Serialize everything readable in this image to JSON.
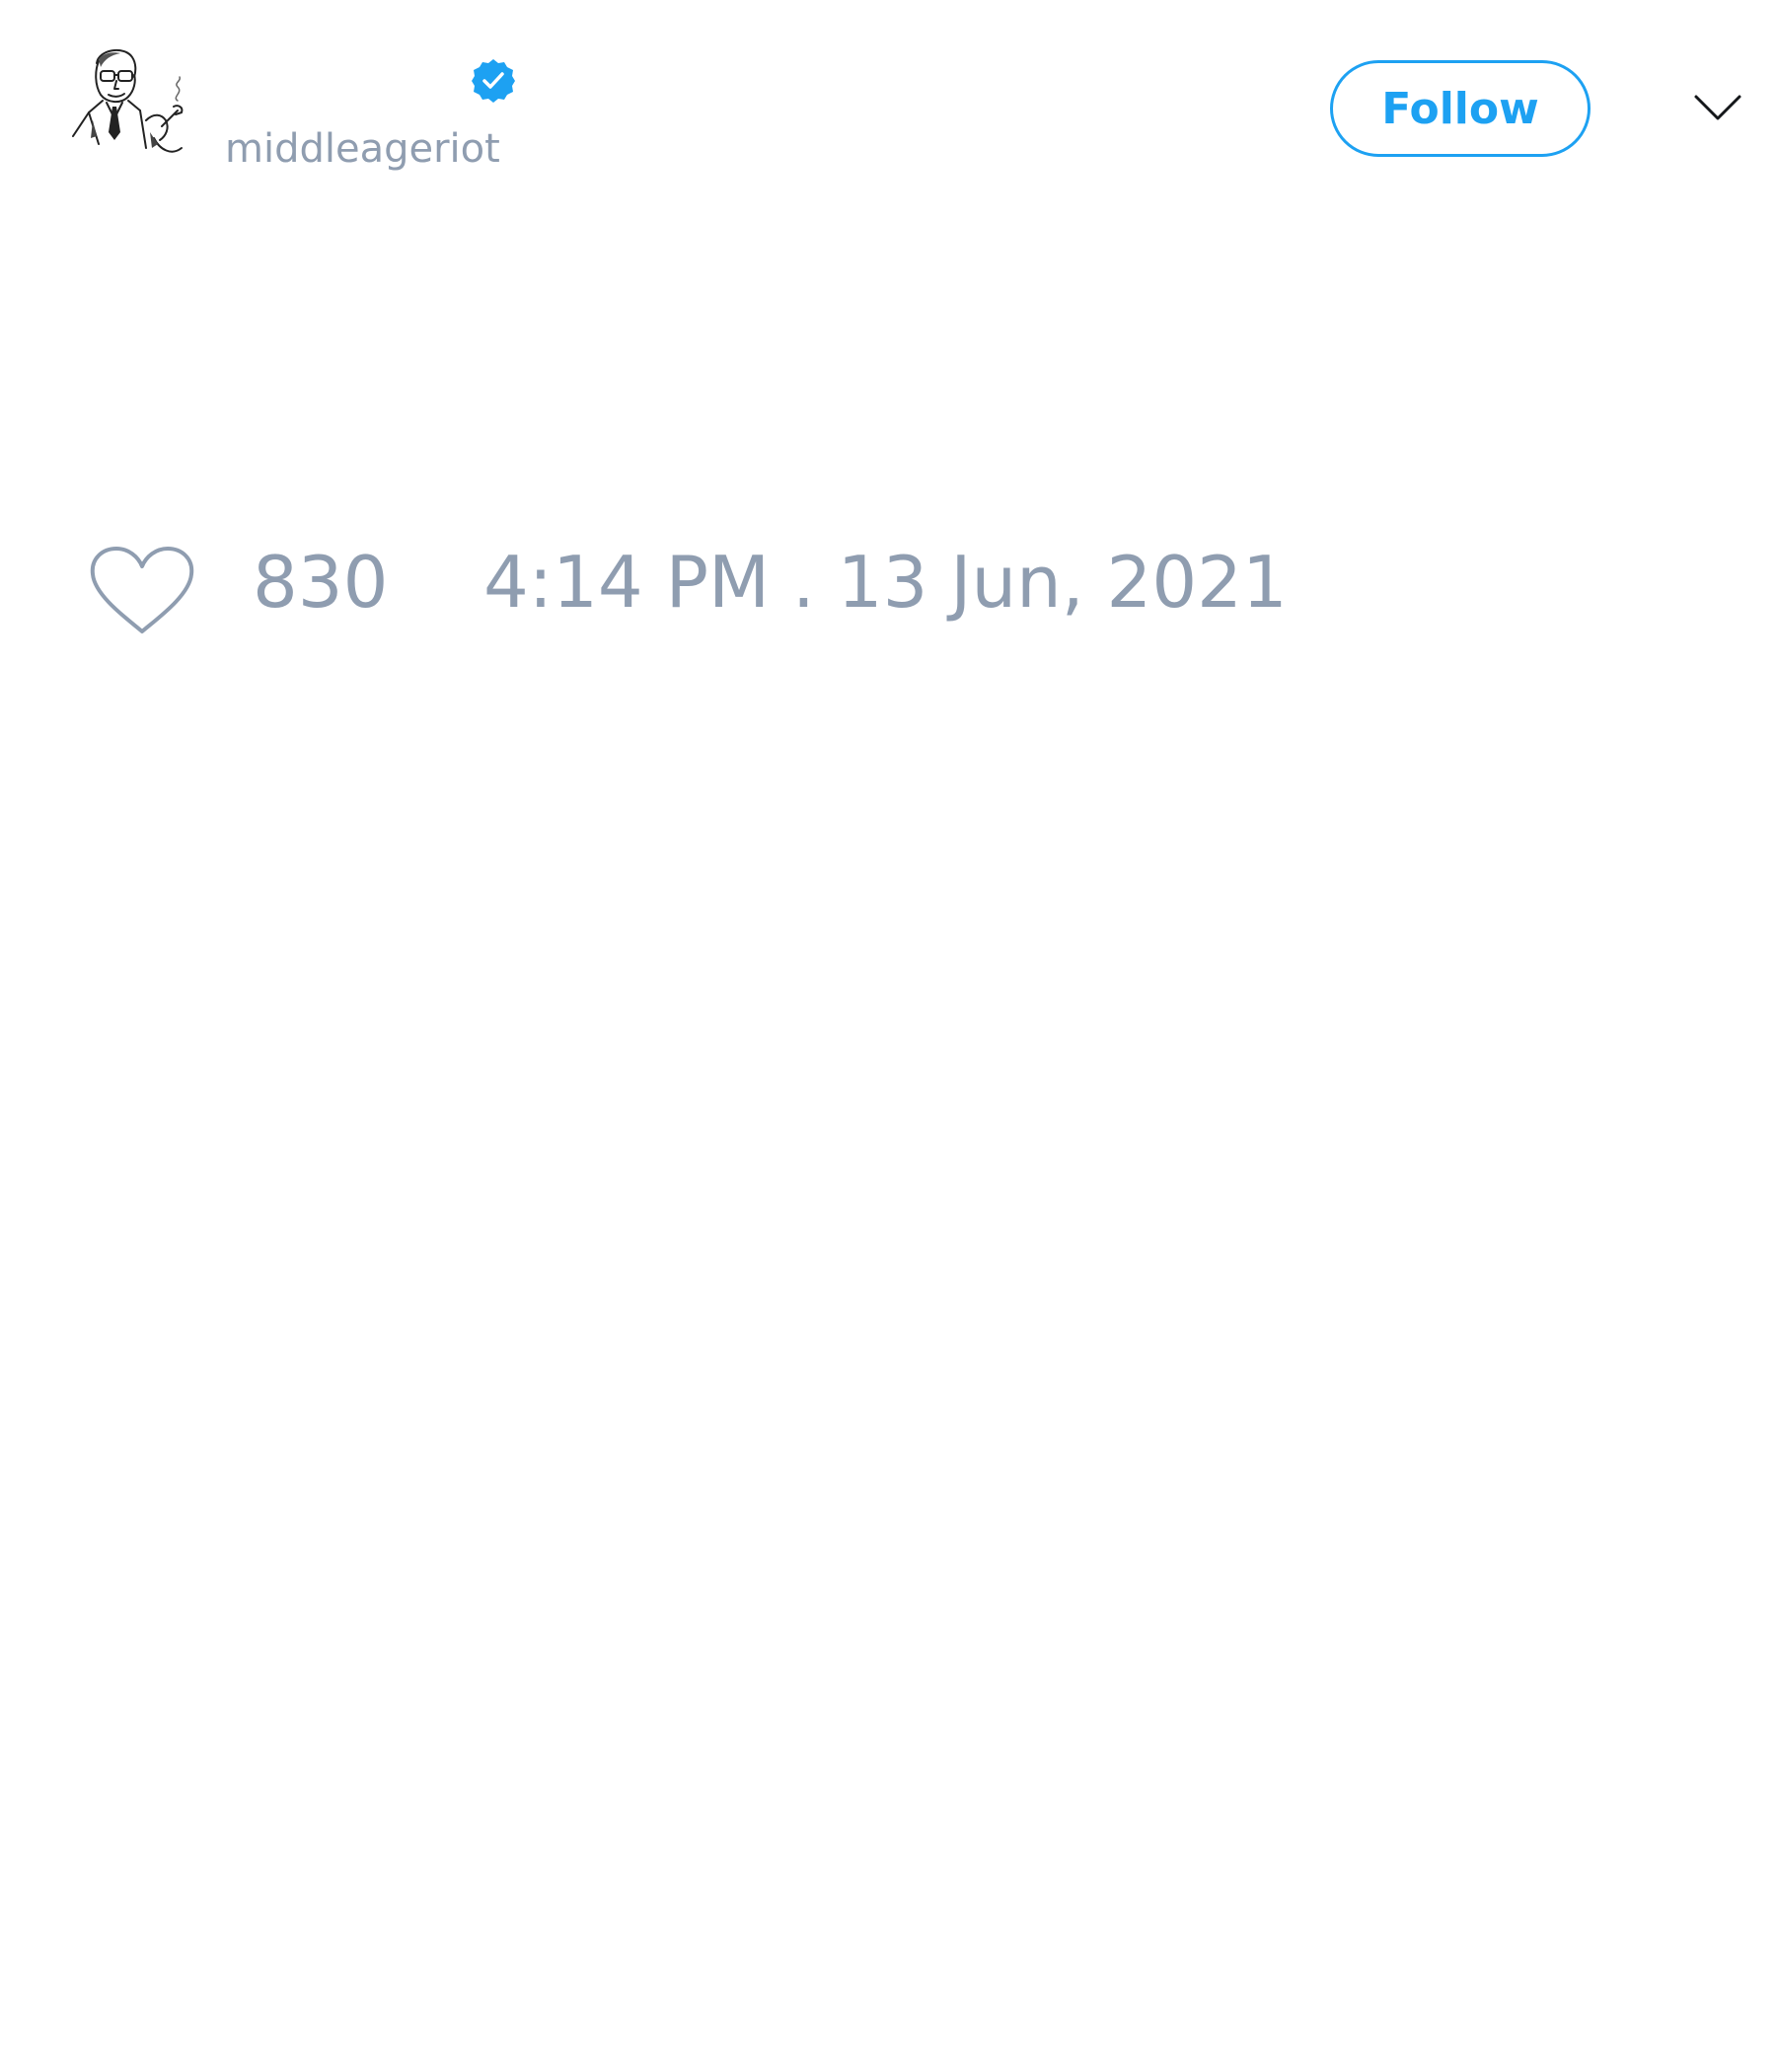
{
  "tweet": {
    "author": {
      "display_name": "",
      "handle": "middleageriot",
      "verified": true,
      "avatar_icon": "sketch-portrait-man-with-glasses-and-pipe"
    },
    "follow_label": "Follow",
    "menu_icon": "chevron-down-icon",
    "likes": "830",
    "timestamp": "4:14 PM . 13 Jun, 2021"
  },
  "colors": {
    "accent": "#1da1f2",
    "muted_text": "#8f9db0",
    "background": "#ffffff"
  }
}
